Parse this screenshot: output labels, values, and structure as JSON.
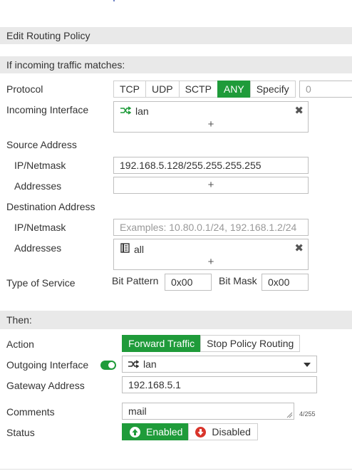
{
  "header": {
    "title": "Edit Routing Policy"
  },
  "match_section": {
    "heading": "If incoming traffic matches:"
  },
  "protocol": {
    "label": "Protocol",
    "options": [
      "TCP",
      "UDP",
      "SCTP",
      "ANY",
      "Specify"
    ],
    "selected": "ANY",
    "specify_value": "0"
  },
  "incoming_interface": {
    "label": "Incoming Interface",
    "entries": [
      "lan"
    ],
    "add_symbol": "+",
    "remove_symbol": "✖"
  },
  "source": {
    "heading": "Source Address",
    "ip_label": "IP/Netmask",
    "ip_value": "192.168.5.128/255.255.255.255",
    "addresses_label": "Addresses",
    "add_symbol": "+"
  },
  "destination": {
    "heading": "Destination Address",
    "ip_label": "IP/Netmask",
    "ip_placeholder": "Examples: 10.80.0.1/24, 192.168.1.2/24",
    "addresses_label": "Addresses",
    "entries": [
      "all"
    ],
    "add_symbol": "+",
    "remove_symbol": "✖"
  },
  "tos": {
    "label": "Type of Service",
    "bit_pattern_label": "Bit Pattern",
    "bit_pattern_value": "0x00",
    "bit_mask_label": "Bit Mask",
    "bit_mask_value": "0x00"
  },
  "then_section": {
    "heading": "Then:"
  },
  "action": {
    "label": "Action",
    "options": [
      "Forward Traffic",
      "Stop Policy Routing"
    ],
    "selected": "Forward Traffic"
  },
  "outgoing_interface": {
    "label": "Outgoing Interface",
    "value": "lan",
    "toggle_on": true
  },
  "gateway": {
    "label": "Gateway Address",
    "value": "192.168.5.1"
  },
  "comments": {
    "label": "Comments",
    "value": "mail",
    "counter": "4/255"
  },
  "status": {
    "label": "Status",
    "enabled_label": "Enabled",
    "disabled_label": "Disabled",
    "selected": "Enabled"
  },
  "colors": {
    "accent": "#1f9b3a",
    "disabled_icon": "#d9342b",
    "section_bg": "#e9e9e9"
  },
  "icons": {
    "interface": "interface-arrows-icon",
    "address": "address-book-icon"
  }
}
